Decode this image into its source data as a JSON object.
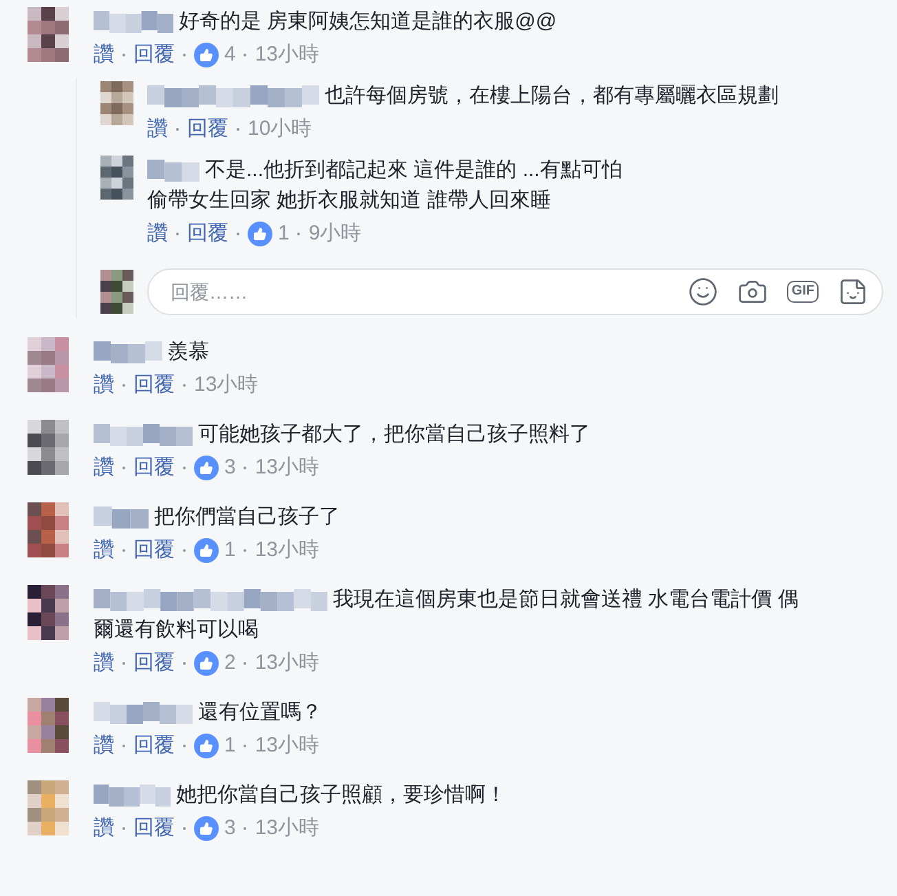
{
  "comments": [
    {
      "text": "好奇的是 房東阿姨怎知道是誰的衣服@@",
      "actions": [
        "讚",
        "回覆"
      ],
      "likes": "4",
      "time": "13小時",
      "replies": [
        {
          "text": "也許每個房號，在樓上陽台，都有專屬曬衣區規劃",
          "actions": [
            "讚",
            "回覆"
          ],
          "time": "10小時"
        },
        {
          "text": "不是...他折到都記起來 這件是誰的 ...有點可怕",
          "continuation": "偷帶女生回家 她折衣服就知道 誰帶人回來睡",
          "actions": [
            "讚",
            "回覆"
          ],
          "likes": "1",
          "time": "9小時"
        }
      ],
      "reply_box": {
        "placeholder": "回覆……",
        "gif": "GIF"
      }
    },
    {
      "text": "羨慕",
      "actions": [
        "讚",
        "回覆"
      ],
      "time": "13小時"
    },
    {
      "text": "可能她孩子都大了，把你當自己孩子照料了",
      "actions": [
        "讚",
        "回覆"
      ],
      "likes": "3",
      "time": "13小時"
    },
    {
      "text": "把你們當自己孩子了",
      "actions": [
        "讚",
        "回覆"
      ],
      "likes": "1",
      "time": "13小時"
    },
    {
      "text": "我現在這個房東也是節日就會送禮 水電台電計價 偶",
      "continuation": "爾還有飲料可以喝",
      "actions": [
        "讚",
        "回覆"
      ],
      "likes": "2",
      "time": "13小時"
    },
    {
      "text": "還有位置嗎？",
      "actions": [
        "讚",
        "回覆"
      ],
      "likes": "1",
      "time": "13小時"
    },
    {
      "text": "她把你當自己孩子照顧，要珍惜啊！",
      "actions": [
        "讚",
        "回覆"
      ],
      "likes": "3",
      "time": "13小時"
    }
  ]
}
